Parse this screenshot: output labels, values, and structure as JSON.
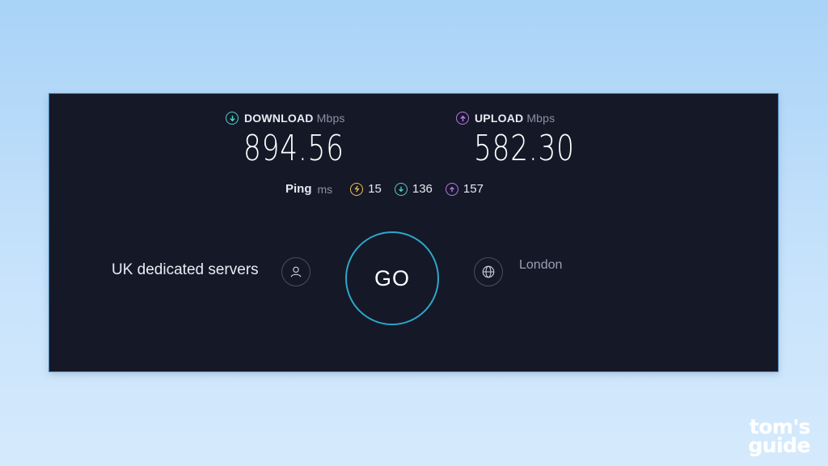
{
  "download": {
    "label": "DOWNLOAD",
    "unit": "Mbps",
    "value": "894.56",
    "icon": "arrow-down-circle-icon",
    "color": "#4fd1c5"
  },
  "upload": {
    "label": "UPLOAD",
    "unit": "Mbps",
    "value": "582.30",
    "icon": "arrow-up-circle-icon",
    "color": "#b57be8"
  },
  "ping": {
    "label": "Ping",
    "unit": "ms",
    "idle": "15",
    "download": "136",
    "upload": "157",
    "idle_color": "#f2c14e"
  },
  "go_button": {
    "label": "GO",
    "ring_color": "#2fa6c8"
  },
  "provider": {
    "name": "UK dedicated servers",
    "icon": "user-icon"
  },
  "server": {
    "location": "London",
    "icon": "globe-icon"
  },
  "watermark": {
    "line1": "tom's",
    "line2": "guide"
  }
}
